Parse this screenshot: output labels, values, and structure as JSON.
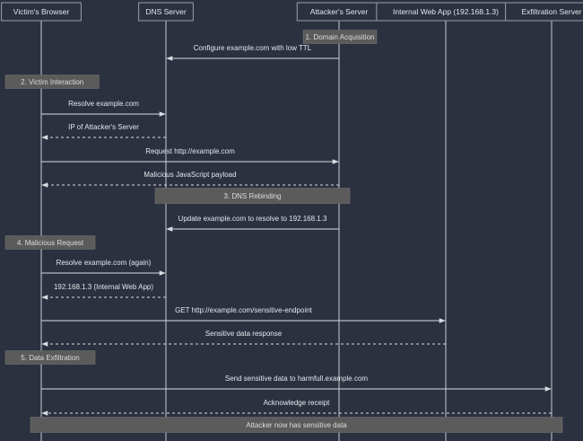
{
  "participants": [
    {
      "id": "victim",
      "label": "Victim's Browser"
    },
    {
      "id": "dns",
      "label": "DNS Server"
    },
    {
      "id": "attacker",
      "label": "Attacker's Server"
    },
    {
      "id": "internal",
      "label": "Internal Web App (192.168.1.3)"
    },
    {
      "id": "exfil",
      "label": "Exfiltration Server"
    }
  ],
  "events": [
    {
      "kind": "note",
      "text": "1. Domain Acquisition",
      "over": [
        "attacker"
      ]
    },
    {
      "kind": "message",
      "text": "Configure example.com with low TTL",
      "from": "attacker",
      "to": "dns",
      "style": "solid"
    },
    {
      "kind": "note",
      "text": "2. Victim Interaction",
      "over": [
        "victim"
      ]
    },
    {
      "kind": "message",
      "text": "Resolve example.com",
      "from": "victim",
      "to": "dns",
      "style": "solid"
    },
    {
      "kind": "message",
      "text": "IP of Attacker's Server",
      "from": "dns",
      "to": "victim",
      "style": "dashed"
    },
    {
      "kind": "message",
      "text": "Request http://example.com",
      "from": "victim",
      "to": "attacker",
      "style": "solid"
    },
    {
      "kind": "message",
      "text": "Malicious JavaScript payload",
      "from": "attacker",
      "to": "victim",
      "style": "dashed"
    },
    {
      "kind": "note",
      "text": "3. DNS Rebinding",
      "over": [
        "dns",
        "attacker"
      ]
    },
    {
      "kind": "message",
      "text": "Update example.com to resolve to 192.168.1.3",
      "from": "attacker",
      "to": "dns",
      "style": "solid"
    },
    {
      "kind": "note",
      "text": "4. Malicious Request",
      "over": [
        "victim"
      ]
    },
    {
      "kind": "message",
      "text": "Resolve example.com (again)",
      "from": "victim",
      "to": "dns",
      "style": "solid"
    },
    {
      "kind": "message",
      "text": "192.168.1.3 (Internal Web App)",
      "from": "dns",
      "to": "victim",
      "style": "dashed"
    },
    {
      "kind": "message",
      "text": "GET http://example.com/sensitive-endpoint",
      "from": "victim",
      "to": "internal",
      "style": "solid"
    },
    {
      "kind": "message",
      "text": "Sensitive data response",
      "from": "internal",
      "to": "victim",
      "style": "dashed"
    },
    {
      "kind": "note",
      "text": "5. Data Exfiltration",
      "over": [
        "victim"
      ]
    },
    {
      "kind": "message",
      "text": "Send sensitive data to harmfull.example.com",
      "from": "victim",
      "to": "exfil",
      "style": "solid"
    },
    {
      "kind": "message",
      "text": "Acknowledge receipt",
      "from": "exfil",
      "to": "victim",
      "style": "dashed"
    },
    {
      "kind": "note",
      "text": "Attacker now has sensitive data",
      "over": [
        "victim",
        "exfil"
      ]
    }
  ],
  "colors": {
    "background": "#2b313f",
    "line": "#d8dbe0",
    "note_fill": "#5b5b5b",
    "text": "#e4e6ea"
  }
}
